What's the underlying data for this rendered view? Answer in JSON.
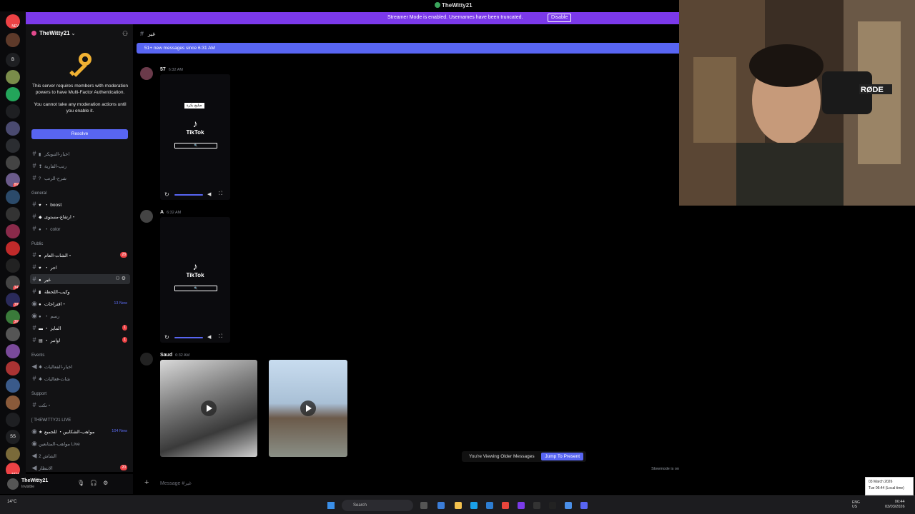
{
  "window": {
    "title": "TheWitty21"
  },
  "banner": {
    "text": "Streamer Mode is enabled. Usernames have been truncated.",
    "button": "Disable"
  },
  "server": {
    "name": "TheWitty21"
  },
  "mfa": {
    "text1": "This server requires members with moderation powers to have Multi-Factor Authentication.",
    "text2": "You cannot take any moderation actions until you enable it.",
    "button": "Resolve"
  },
  "channels_top": [
    {
      "name": "اخبار-التبويكر"
    },
    {
      "name": "رتب-الفارية"
    },
    {
      "name": "شرح-الرتب"
    }
  ],
  "categories": {
    "general": "General",
    "public": "Public",
    "events": "Events",
    "support": "Support",
    "live": "[ THEWITTY21 LIVE"
  },
  "channels_general": [
    {
      "name": "・ boost"
    },
    {
      "name": "ارتفاع-مستوى・"
    },
    {
      "name": "・ color"
    }
  ],
  "channels_public": [
    {
      "name": "الشات-العام・",
      "badge": "28"
    },
    {
      "name": "・ اجر"
    },
    {
      "name": "غير",
      "active": true
    },
    {
      "name": "وكيب-اللحظة"
    },
    {
      "name": "اقتراحات・",
      "new": "13 New"
    },
    {
      "name": "・ رسم"
    },
    {
      "name": "・ المايز",
      "badge": "1"
    },
    {
      "name": "・ اوامر",
      "badge": "1"
    }
  ],
  "channels_events": [
    {
      "name": "اخبار-الفعاليات"
    },
    {
      "name": "شات-فعاليات"
    }
  ],
  "channels_support": [
    {
      "name": "تكت・"
    }
  ],
  "channels_live": [
    {
      "name": "مواهب-الشكابين・ للجميع",
      "new": "104 New"
    },
    {
      "name": "مواهب-المتابعين Live"
    },
    {
      "name": "2 الشاش"
    },
    {
      "name": "الانتظار",
      "badge": "20"
    }
  ],
  "user": {
    "name": "TheWitty21",
    "status": "Invisible"
  },
  "chat": {
    "channel": "غير",
    "new_messages": "51+ new messages since 6:31 AM",
    "messages": [
      {
        "author": "57",
        "time": "6:32 AM"
      },
      {
        "author": "A",
        "time": "6:32 AM"
      },
      {
        "author": "Saud",
        "time": "6:32 AM"
      }
    ],
    "video_label": "TikTok",
    "video_caption": "صليح بكرة",
    "older_text": "You're Viewing Older Messages",
    "jump_button": "Jump To Present",
    "composer_placeholder": "Message #غير",
    "slowmode": "Slowmode is on"
  },
  "taskbar": {
    "weather": "14°C",
    "search": "Search",
    "lang": "ENG",
    "region": "US",
    "time": "06:44",
    "date": "03/03/2026",
    "popup_date": "03 March 2026",
    "popup_time": "Tue 06:44 (Local time)"
  },
  "colors": {
    "accent": "#5865f2",
    "banner": "#7b39ea",
    "danger": "#ed4245"
  }
}
